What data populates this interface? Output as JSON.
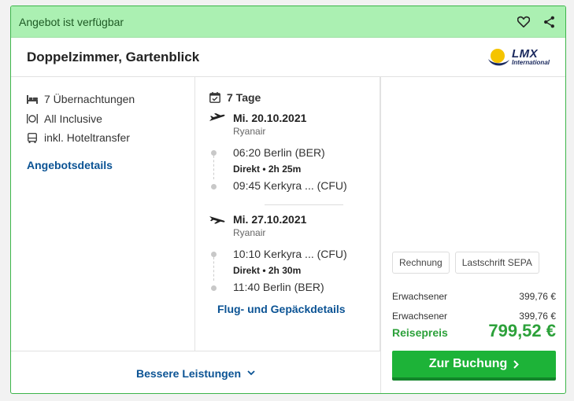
{
  "banner": {
    "text": "Angebot ist verfügbar",
    "icons": [
      "heart-icon",
      "share-icon"
    ]
  },
  "offer": {
    "title": "Doppelzimmer, Gartenblick",
    "logo_main": "LMX",
    "logo_sub": "International"
  },
  "features": [
    {
      "icon": "bed-icon",
      "label": "7 Übernachtungen"
    },
    {
      "icon": "cutlery-icon",
      "label": "All Inclusive"
    },
    {
      "icon": "bus-icon",
      "label": "inkl. Hoteltransfer"
    }
  ],
  "offer_details_link": "Angebotsdetails",
  "trip": {
    "duration": "7 Tage",
    "outbound": {
      "date": "Mi. 20.10.2021",
      "airline": "Ryanair",
      "departure": "06:20 Berlin (BER)",
      "direct": "Direkt  •  2h 25m",
      "arrival": "09:45 Kerkyra ...  (CFU)"
    },
    "return": {
      "date": "Mi. 27.10.2021",
      "airline": "Ryanair",
      "departure": "10:10 Kerkyra ...  (CFU)",
      "direct": "Direkt  •  2h 30m",
      "arrival": "11:40 Berlin (BER)"
    },
    "details_link": "Flug- und Gepäckdetails"
  },
  "payment": {
    "methods": [
      "Rechnung",
      "Lastschrift SEPA"
    ]
  },
  "prices": [
    {
      "label": "Erwachsener",
      "value": "399,76 €"
    },
    {
      "label": "Erwachsener",
      "value": "399,76 €"
    }
  ],
  "total": {
    "label": "Reisepreis",
    "value": "799,52 €"
  },
  "book_button": "Zur Buchung",
  "better_services": "Bessere Leistungen",
  "colors": {
    "accent_green": "#1db338",
    "banner_bg": "#abf0b2",
    "link_blue": "#0b5394"
  }
}
